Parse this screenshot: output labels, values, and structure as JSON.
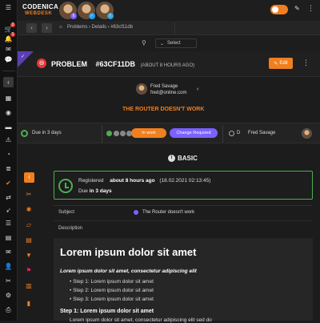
{
  "app": {
    "brand_name": "CODENICA",
    "brand_sub": "WEBDESK",
    "accent": "#f07f1f"
  },
  "sidebar": {
    "badges": {
      "cart": "2",
      "bell": "1"
    }
  },
  "topbar": {
    "avatar_badges": [
      "6",
      "✓",
      "t"
    ]
  },
  "nav": {
    "back": "‹",
    "forward": "›",
    "breadcrumb": "Problems › Details › #63cf11db"
  },
  "selectbar": {
    "pin": "⚲",
    "select_label": "Select"
  },
  "problem": {
    "type": "PROBLEM",
    "id": "#63CF11DB",
    "ago": "(ABOUT 8 HOURS AGO)",
    "edit_label": "Edit",
    "assignee_name": "Fred Savage",
    "assignee_email": "fred@online.com",
    "subject": "THE ROUTER DOESN'T WORK"
  },
  "status": {
    "due": "Due in 3 days",
    "status_label": "In work",
    "substatus_label": "Change Required",
    "owner_name": "Fred Savage",
    "owner_short": "D"
  },
  "section": {
    "title": "BASIC"
  },
  "registered": {
    "label": "Registered",
    "ago": "about 8 hours ago",
    "date": "(18.02.2021 02:13:45)",
    "due_label": "Due",
    "due_value": "in 3 days"
  },
  "fields": {
    "subject_label": "Subject",
    "subject_value": "The Router doesn't work",
    "description_label": "Description"
  },
  "description": {
    "heading": "Lorem ipsum dolor sit amet",
    "lead": "Lorem ipsum dolor sit amet, consectetur adipiscing elit",
    "steps": [
      "Step 1: Lorem ipsum dolor sit amet",
      "Step 2: Lorem ipsum dolor sit amet",
      "Step 3: Lorem ipsum dolor sit amet"
    ],
    "subheading": "Step 1: Lorem ipsum dolor sit amet",
    "tail": "Lorem ipsum dolor sit amet, consectetur adipiscing elit sed do"
  },
  "colors": {
    "orange": "#f07f1f",
    "green": "#4caf50",
    "purple": "#7b61ff",
    "red": "#e53935",
    "corner": "#5b3fb4"
  }
}
